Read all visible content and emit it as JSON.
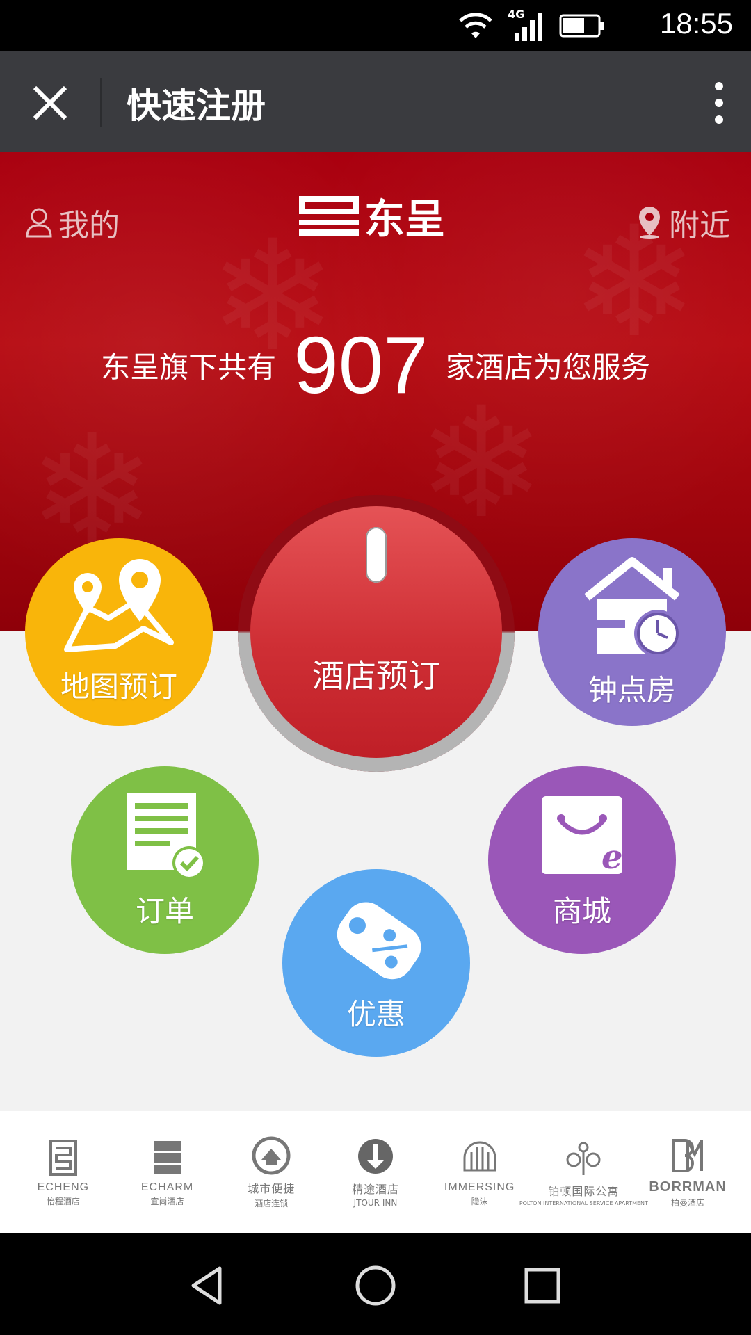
{
  "status_bar": {
    "time": "18:55",
    "network": "4G"
  },
  "header": {
    "title": "快速注册"
  },
  "banner": {
    "mine_label": "我的",
    "nearby_label": "附近",
    "brand_name": "东呈",
    "count_prefix": "东呈旗下共有",
    "count_value": "907",
    "count_suffix": "家酒店为您服务"
  },
  "menu": {
    "hotel_booking": "酒店预订",
    "map_booking": "地图预订",
    "hourly_room": "钟点房",
    "orders": "订单",
    "mall": "商城",
    "promotions": "优惠"
  },
  "brands": [
    {
      "name": "ECHENG",
      "sub": "怡程酒店"
    },
    {
      "name": "ECHARM",
      "sub": "宜尚酒店"
    },
    {
      "name": "城市便捷",
      "sub": "酒店连锁"
    },
    {
      "name": "精途酒店",
      "sub": "JTOUR INN"
    },
    {
      "name": "IMMERSING",
      "sub": "隐沫"
    },
    {
      "name": "铂顿国际公寓",
      "sub": "POLTON INTERNATIONAL SERVICE APARTMENT"
    },
    {
      "name": "BORRMAN",
      "sub": "柏曼酒店"
    }
  ],
  "colors": {
    "header_bg": "#3a3b3f",
    "banner_red": "#b70b12",
    "map_yellow": "#f9b50a",
    "hourly_purple": "#8a74c9",
    "orders_green": "#7fc046",
    "mall_purple": "#9a57b8",
    "promo_blue": "#5aa8f0"
  }
}
